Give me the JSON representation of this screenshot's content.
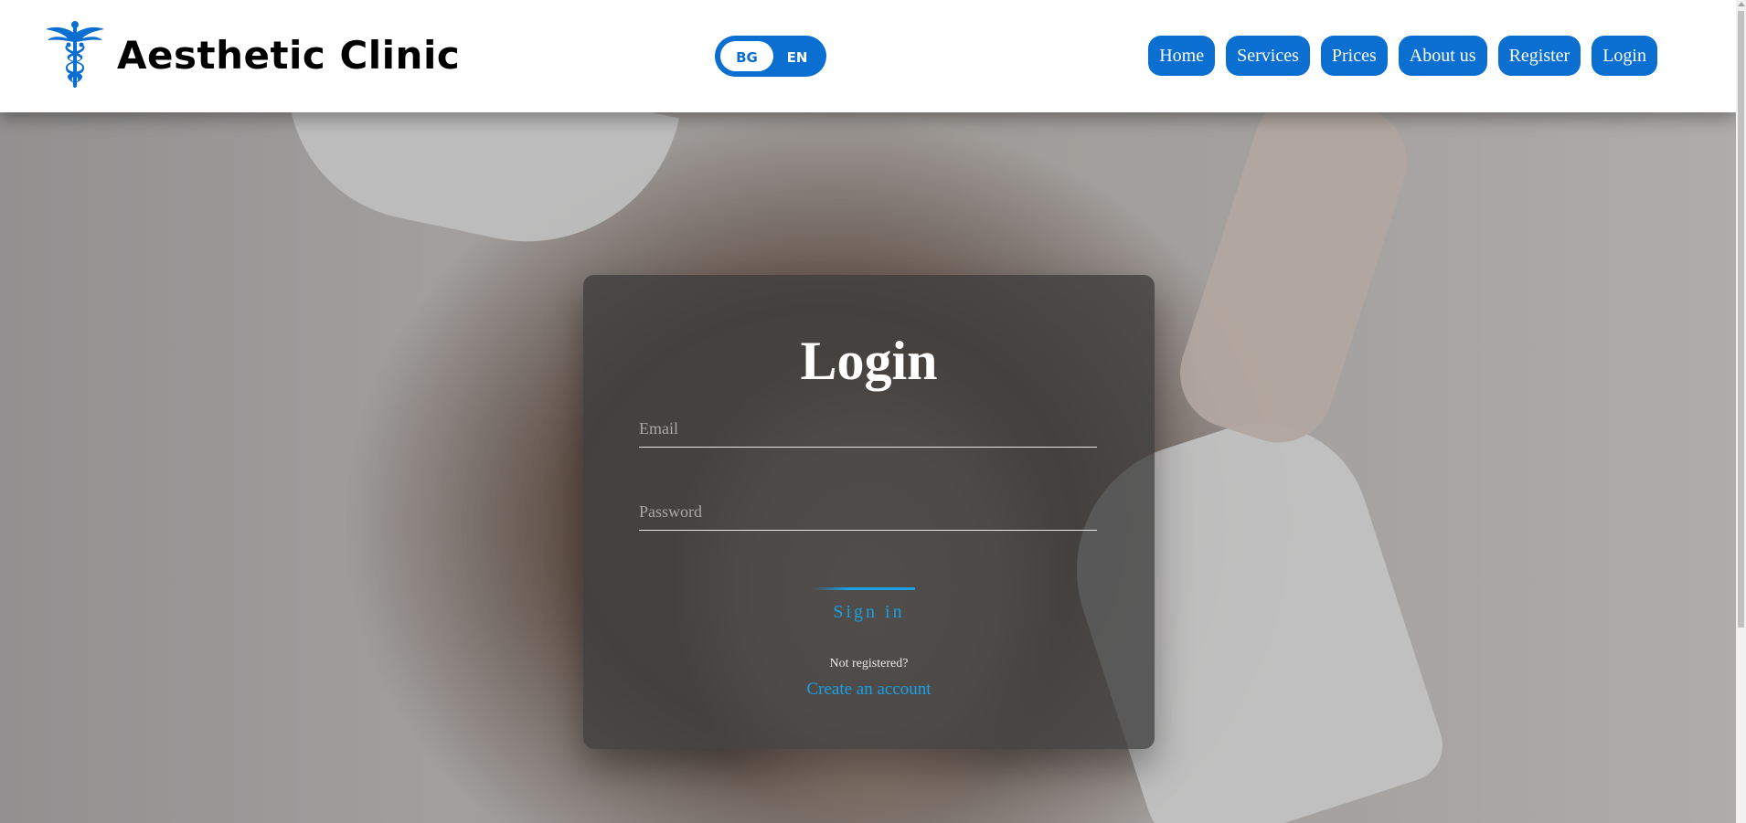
{
  "brand": {
    "name": "Aesthetic Clinic",
    "logo_icon": "caduceus-icon",
    "accent_color": "#0a6fd1"
  },
  "language_toggle": {
    "options": [
      "BG",
      "EN"
    ],
    "selected": "BG"
  },
  "nav": {
    "items": [
      {
        "label": "Home"
      },
      {
        "label": "Services"
      },
      {
        "label": "Prices"
      },
      {
        "label": "About us"
      },
      {
        "label": "Register"
      },
      {
        "label": "Login"
      }
    ]
  },
  "login": {
    "title": "Login",
    "email": {
      "placeholder": "Email",
      "value": ""
    },
    "password": {
      "placeholder": "Password",
      "value": ""
    },
    "sign_in_label": "Sign in",
    "not_registered_text": "Not registered?",
    "create_account_label": "Create an account",
    "link_color": "#1aa0e6"
  }
}
